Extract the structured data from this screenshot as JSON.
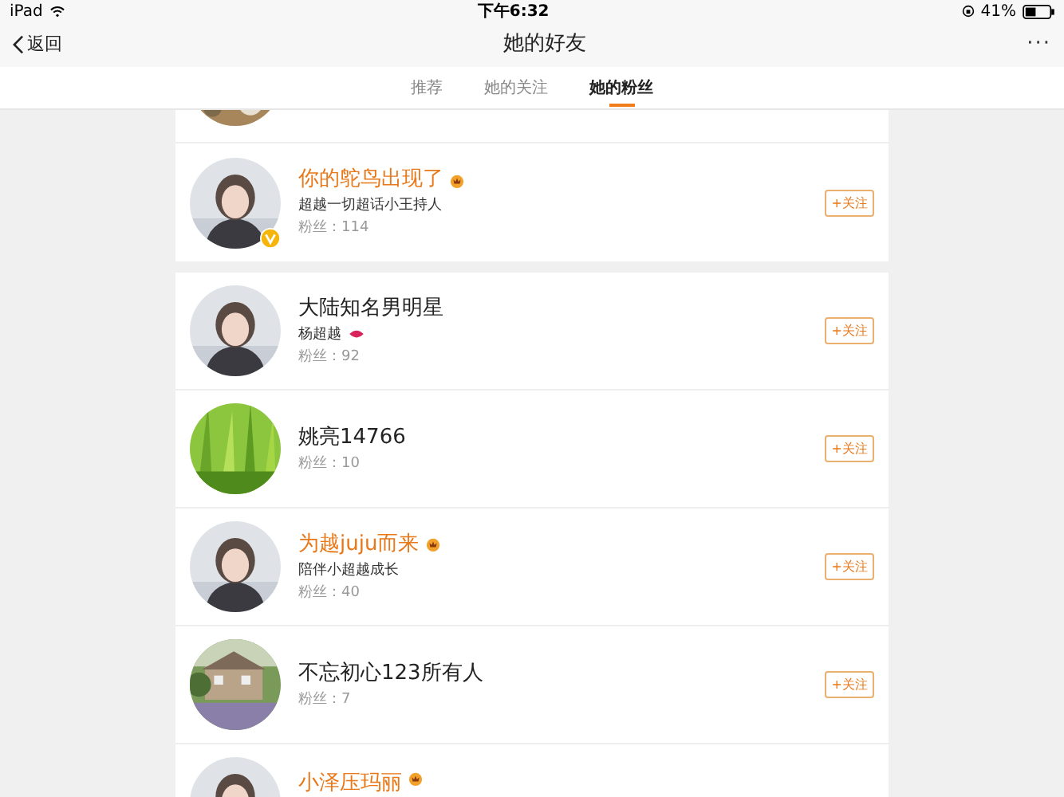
{
  "status_bar": {
    "device": "iPad",
    "time": "下午6:32",
    "battery": "41%"
  },
  "nav": {
    "back": "返回",
    "title": "她的好友",
    "more": "···"
  },
  "tabs": [
    {
      "label": "推荐",
      "selected": false
    },
    {
      "label": "她的关注",
      "selected": false
    },
    {
      "label": "她的粉丝",
      "selected": true
    }
  ],
  "cards": [
    {
      "items": [
        {
          "kind": "clipped"
        },
        {
          "kind": "user",
          "name": "你的鸵鸟出现了",
          "vip": true,
          "verified": true,
          "bio": "超越一切超话小王持人",
          "bio_emoji": false,
          "fans": "粉丝：114",
          "button": "+关注"
        }
      ]
    },
    {
      "items": [
        {
          "kind": "user",
          "name": "大陆知名男明星",
          "vip": false,
          "verified": false,
          "bio": "杨超越",
          "bio_emoji": true,
          "fans": "粉丝：92",
          "button": "+关注"
        },
        {
          "kind": "user",
          "name": "姚亮14766",
          "vip": false,
          "verified": false,
          "fans": "粉丝：10",
          "button": "+关注"
        },
        {
          "kind": "user",
          "name": "为越juju而来",
          "vip": true,
          "verified": false,
          "bio": "陪伴小超越成长",
          "bio_emoji": false,
          "fans": "粉丝：40",
          "button": "+关注"
        },
        {
          "kind": "user",
          "name": "不忘初心123所有人",
          "vip": false,
          "verified": false,
          "fans": "粉丝：7",
          "button": "+关注"
        },
        {
          "kind": "cut",
          "name": "小泽压玛丽",
          "vip": true
        }
      ]
    }
  ]
}
